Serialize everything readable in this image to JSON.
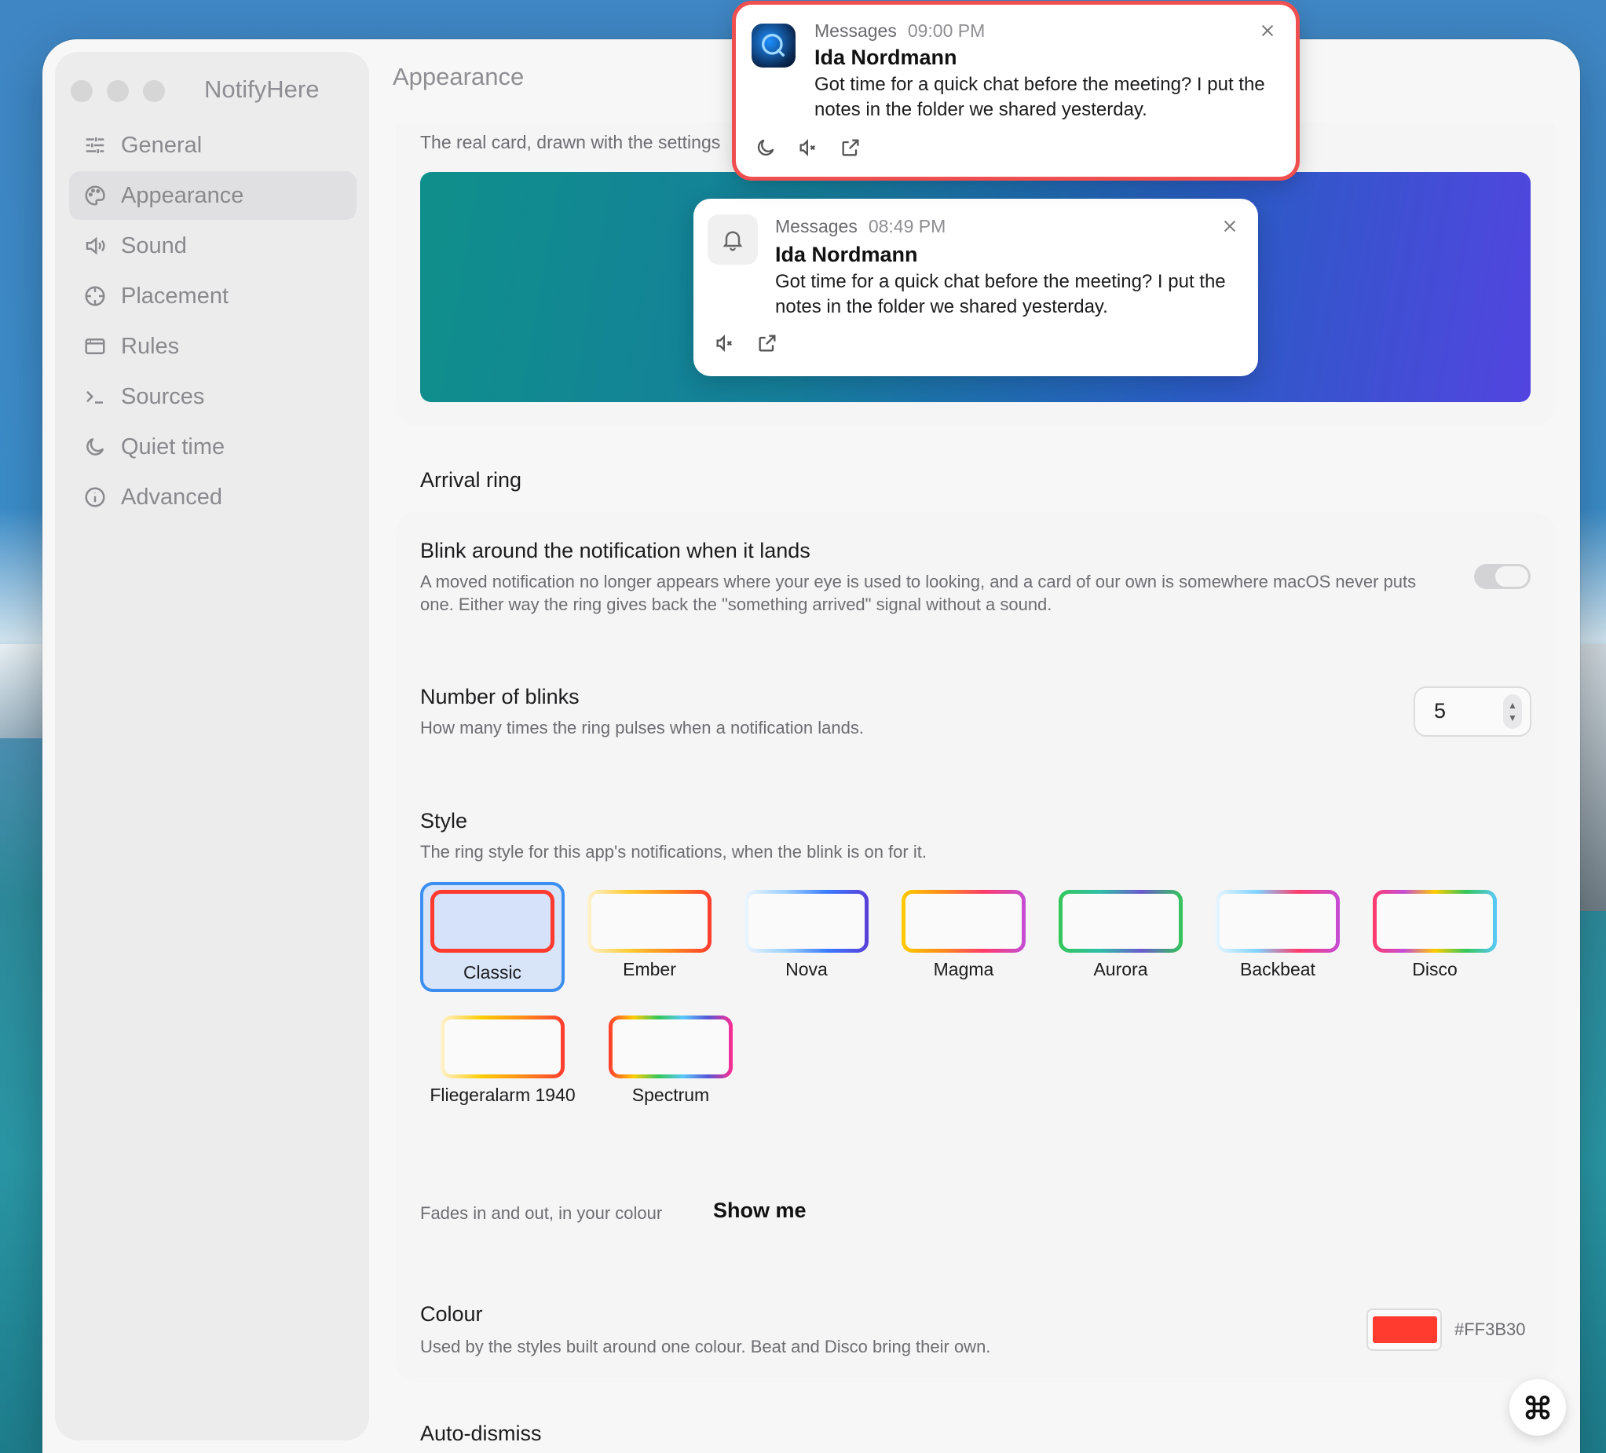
{
  "app": {
    "name": "NotifyHere"
  },
  "sidebar": {
    "items": [
      {
        "label": "General",
        "icon": "sliders-icon"
      },
      {
        "label": "Appearance",
        "icon": "palette-icon",
        "active": true
      },
      {
        "label": "Sound",
        "icon": "speaker-icon"
      },
      {
        "label": "Placement",
        "icon": "crosshair-icon"
      },
      {
        "label": "Rules",
        "icon": "window-icon"
      },
      {
        "label": "Sources",
        "icon": "terminal-icon"
      },
      {
        "label": "Quiet time",
        "icon": "moon-icon"
      },
      {
        "label": "Advanced",
        "icon": "info-icon"
      }
    ]
  },
  "header": {
    "title": "Appearance"
  },
  "preview": {
    "caption": "The real card, drawn with the settings",
    "card": {
      "app": "Messages",
      "time": "08:49 PM",
      "sender": "Ida Nordmann",
      "message": "Got time for a quick chat before the meeting? I put the notes in the folder we shared yesterday."
    }
  },
  "live_notification": {
    "app": "Messages",
    "time": "09:00 PM",
    "sender": "Ida Nordmann",
    "message": "Got time for a quick chat before the meeting? I put the notes in the folder we shared yesterday.",
    "ring_color": "#EF4F4F"
  },
  "arrival_ring": {
    "section_title": "Arrival ring",
    "blink": {
      "title": "Blink around the notification when it lands",
      "description": "A moved notification no longer appears where your eye is used to looking, and a card of our own is somewhere macOS never puts one. Either way the ring gives back the \"something arrived\" signal without a sound.",
      "enabled": true
    },
    "blinks": {
      "title": "Number of blinks",
      "description": "How many times the ring pulses when a notification lands.",
      "value": "5"
    },
    "style": {
      "title": "Style",
      "description": "The ring style for this app's notifications, when the blink is on for it.",
      "options": [
        "Classic",
        "Ember",
        "Nova",
        "Magma",
        "Aurora",
        "Backbeat",
        "Disco",
        "Fliegeralarm 1940",
        "Spectrum"
      ],
      "selected": "Classic",
      "hint": "Fades in and out, in your colour",
      "show_me_label": "Show me"
    },
    "colour": {
      "title": "Colour",
      "description": "Used by the styles built around one colour. Beat and Disco bring their own.",
      "hex": "#FF3B30"
    }
  },
  "auto_dismiss": {
    "section_title": "Auto-dismiss"
  }
}
